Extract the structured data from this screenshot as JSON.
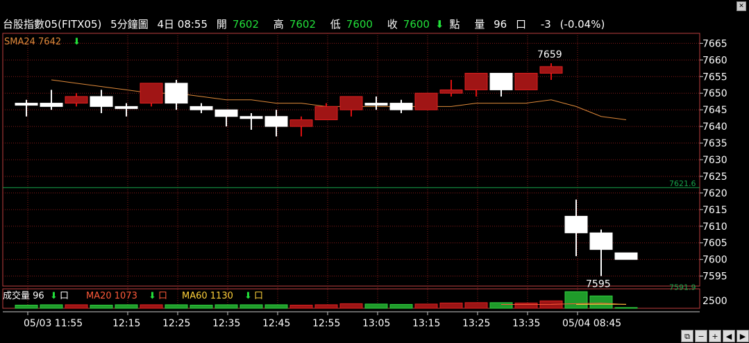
{
  "header": {
    "symbol": "台股指數05(FITX05)",
    "period": "5分鐘圖",
    "date_time": "4日 08:55",
    "open_label": "開",
    "open": "7602",
    "high_label": "高",
    "high": "7602",
    "low_label": "低",
    "low": "7600",
    "close_label": "收",
    "close": "7600",
    "close_arrow": "⬇",
    "points_label": "點",
    "volume_label": "量",
    "volume": "96",
    "volume_unit": "口",
    "change": "-3",
    "change_pct": "(-0.04%)"
  },
  "indicator": {
    "label": "SMA24",
    "value": "7642",
    "arrow": "⬇"
  },
  "volume_panel": {
    "label": "成交量",
    "value": "96",
    "unit": "口",
    "arrow": "⬇",
    "ma20_label": "MA20",
    "ma20": "1073",
    "ma60_label": "MA60",
    "ma60": "1130"
  },
  "price_axis": [
    "7665",
    "7660",
    "7655",
    "7650",
    "7645",
    "7640",
    "7635",
    "7630",
    "7625",
    "7620",
    "7615",
    "7610",
    "7605",
    "7600",
    "7595"
  ],
  "ref_lines": {
    "upper": "7621.6",
    "lower": "7591.9"
  },
  "annotations": {
    "high": "7659",
    "low": "7595"
  },
  "volume_axis": "2500",
  "time_labels": [
    "05/03 11:55",
    "12:15",
    "12:25",
    "12:35",
    "12:45",
    "12:55",
    "13:05",
    "13:15",
    "13:25",
    "13:35",
    "05/04 08:45"
  ],
  "colors": {
    "up": "#e01010",
    "down": "#ffffff",
    "grid": "#8b1a1a",
    "frame": "#c04040",
    "sma": "#e08a3a",
    "ref": "#16a34a",
    "text_green": "#22e03a",
    "ma20": "#ff5a3a",
    "ma60": "#ffd23a"
  },
  "chart_data": {
    "type": "candlestick",
    "ylim": [
      7592,
      7668
    ],
    "candles": [
      {
        "o": 7647,
        "h": 7648,
        "l": 7643,
        "c": 7647
      },
      {
        "o": 7647,
        "h": 7651,
        "l": 7645,
        "c": 7646
      },
      {
        "o": 7647,
        "h": 7650,
        "l": 7646,
        "c": 7649
      },
      {
        "o": 7649,
        "h": 7651,
        "l": 7644,
        "c": 7646
      },
      {
        "o": 7646,
        "h": 7647,
        "l": 7643,
        "c": 7646
      },
      {
        "o": 7647,
        "h": 7653,
        "l": 7646,
        "c": 7653
      },
      {
        "o": 7653,
        "h": 7654,
        "l": 7645,
        "c": 7647
      },
      {
        "o": 7646,
        "h": 7647,
        "l": 7644,
        "c": 7645
      },
      {
        "o": 7645,
        "h": 7645,
        "l": 7640,
        "c": 7643
      },
      {
        "o": 7643,
        "h": 7644,
        "l": 7639,
        "c": 7643
      },
      {
        "o": 7643,
        "h": 7645,
        "l": 7637,
        "c": 7640
      },
      {
        "o": 7640,
        "h": 7643,
        "l": 7637,
        "c": 7642
      },
      {
        "o": 7642,
        "h": 7647,
        "l": 7642,
        "c": 7646
      },
      {
        "o": 7645,
        "h": 7649,
        "l": 7643,
        "c": 7649
      },
      {
        "o": 7647,
        "h": 7649,
        "l": 7645,
        "c": 7647
      },
      {
        "o": 7647,
        "h": 7648,
        "l": 7644,
        "c": 7645
      },
      {
        "o": 7645,
        "h": 7650,
        "l": 7645,
        "c": 7650
      },
      {
        "o": 7650,
        "h": 7654,
        "l": 7649,
        "c": 7651
      },
      {
        "o": 7651,
        "h": 7656,
        "l": 7649,
        "c": 7656
      },
      {
        "o": 7656,
        "h": 7656,
        "l": 7649,
        "c": 7651
      },
      {
        "o": 7651,
        "h": 7656,
        "l": 7651,
        "c": 7656
      },
      {
        "o": 7656,
        "h": 7659,
        "l": 7654,
        "c": 7658
      },
      {
        "o": 7613,
        "h": 7618,
        "l": 7601,
        "c": 7608
      },
      {
        "o": 7608,
        "h": 7609,
        "l": 7595,
        "c": 7603
      },
      {
        "o": 7602,
        "h": 7602,
        "l": 7600,
        "c": 7600
      }
    ],
    "sma24": [
      null,
      7654,
      7653,
      7652,
      7651,
      7650,
      7650,
      7649,
      7648,
      7648,
      7647,
      7647,
      7646,
      7646,
      7646,
      7646,
      7646,
      7646,
      7647,
      7647,
      7647,
      7648,
      7646,
      7643,
      7642
    ],
    "volumes": [
      900,
      1000,
      1000,
      900,
      1000,
      1000,
      1000,
      900,
      1000,
      1000,
      1000,
      900,
      1000,
      1300,
      1200,
      1100,
      1200,
      1500,
      1600,
      1600,
      1500,
      2100,
      4700,
      3500,
      200
    ],
    "ma20": [
      null,
      null,
      null,
      null,
      null,
      null,
      null,
      null,
      null,
      null,
      null,
      null,
      null,
      null,
      null,
      null,
      null,
      null,
      null,
      1073,
      1090,
      1100,
      1300,
      1450,
      1073
    ],
    "ma60": [
      null,
      null,
      null,
      null,
      null,
      null,
      null,
      null,
      null,
      null,
      null,
      null,
      null,
      null,
      null,
      null,
      null,
      null,
      null,
      null,
      null,
      null,
      1100,
      1120,
      1130
    ],
    "vol_ylim": [
      0,
      5500
    ]
  }
}
